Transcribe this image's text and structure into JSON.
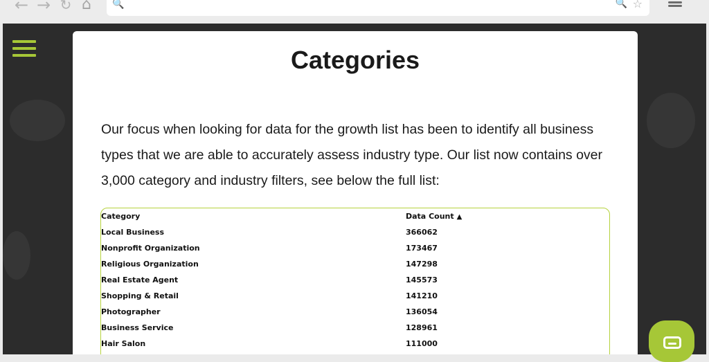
{
  "browser": {
    "back_glyph": "←",
    "forward_glyph": "→",
    "reload_glyph": "↻",
    "home_glyph": "⌂",
    "search_glyph": "🔍",
    "zoom_glyph": "🔍",
    "star_glyph": "☆"
  },
  "colors": {
    "accent": "#a6c737",
    "background": "#2c2c2c"
  },
  "card": {
    "title": "Categories",
    "intro": "Our focus when looking for data for the growth list has been to identify all business types that we are able to accurately assess industry type. Our list now contains over 3,000 category and industry filters, see below the full list:"
  },
  "table": {
    "headers": {
      "category": "Category",
      "data_count": "Data Count",
      "sort_glyph": "▲"
    },
    "rows": [
      {
        "category": "Local Business",
        "count": "366062"
      },
      {
        "category": "Nonprofit Organization",
        "count": "173467"
      },
      {
        "category": "Religious Organization",
        "count": "147298"
      },
      {
        "category": "Real Estate Agent",
        "count": "145573"
      },
      {
        "category": "Shopping & Retail",
        "count": "141210"
      },
      {
        "category": "Photographer",
        "count": "136054"
      },
      {
        "category": "Business Service",
        "count": "128961"
      },
      {
        "category": "Hair Salon",
        "count": "111000"
      }
    ]
  }
}
